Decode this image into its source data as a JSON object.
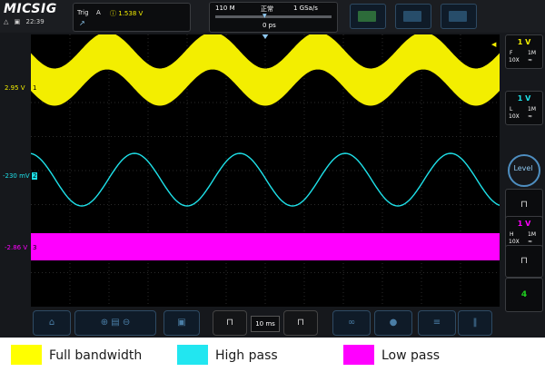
{
  "header": {
    "logo": "MICSIG",
    "status": {
      "wifi_icon": "wifi-icon",
      "network_icon": "network-icon",
      "time": "22:39"
    },
    "trigger": {
      "label": "Trig",
      "source": "A",
      "level_icon": "trigger-level-icon",
      "level": "1.538  V",
      "edge_icon": "rising-edge-icon"
    },
    "timebase": {
      "memory": "110 M",
      "mode": "正常",
      "rate": "1 GSa/s",
      "offset": "0 ps"
    }
  },
  "channels": [
    {
      "name": "1",
      "color": "#f3ee00",
      "offset": "2.95 V",
      "scale": "1 V",
      "coupling": "F",
      "impedance": "1M",
      "probe": "10X"
    },
    {
      "name": "2",
      "color": "#1ee0e8",
      "offset": "-230 mV",
      "scale": "1 V",
      "coupling": "L",
      "impedance": "1M",
      "probe": "10X"
    },
    {
      "name": "3",
      "color": "#ff00ff",
      "offset": "-2.86 V",
      "scale": "1 V",
      "coupling": "H",
      "impedance": "1M",
      "probe": "10X"
    }
  ],
  "right_panel": {
    "level_label": "Level",
    "channel4": "4"
  },
  "bottom_bar": {
    "time_per_div": "10 ms"
  },
  "legend": [
    {
      "label": "Full bandwidth",
      "color": "#ffff00"
    },
    {
      "label": "High pass",
      "color": "#22e6f0"
    },
    {
      "label": "Low pass",
      "color": "#ff00ff"
    }
  ],
  "colors": {
    "background": "#16181c",
    "grid": "#000000",
    "accent": "#4e8ec0"
  }
}
